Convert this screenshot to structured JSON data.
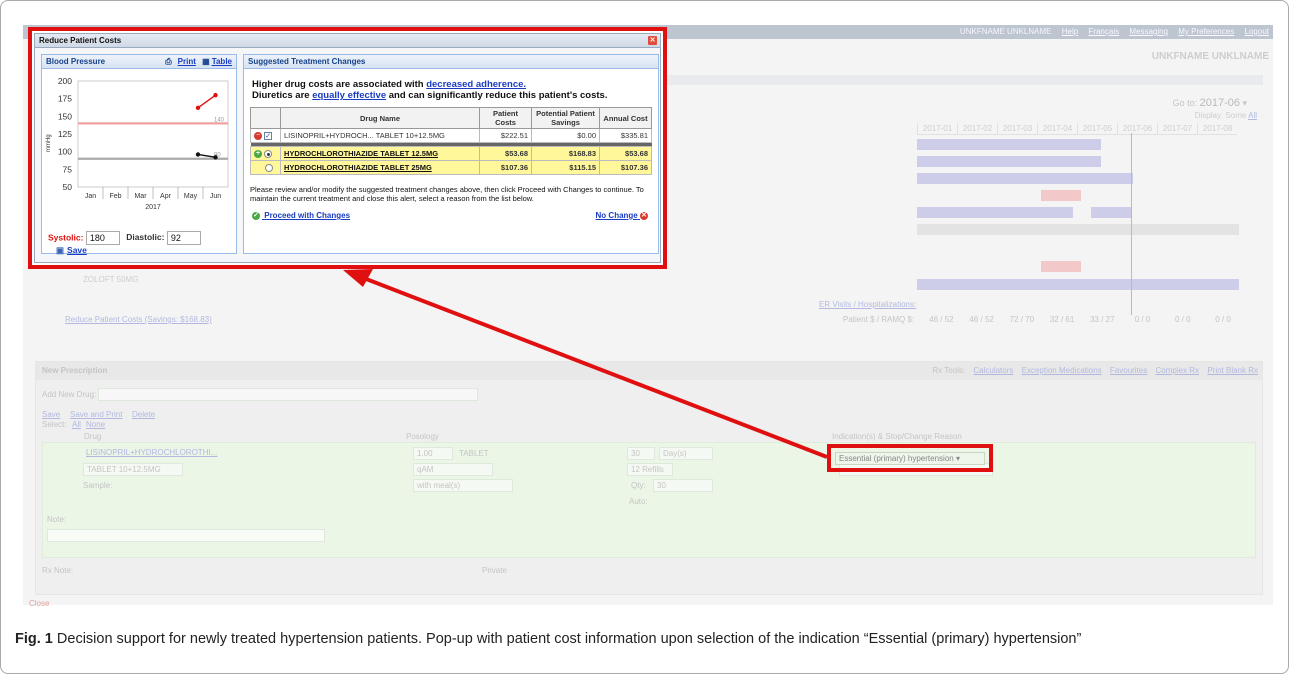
{
  "topbar": {
    "user": "UNKFNAME UNKLNAME",
    "help": "Help",
    "francais": "Français",
    "messaging": "Messaging",
    "preferences": "My Preferences",
    "logout": "Logout"
  },
  "user_name": "UNKFNAME UNKLNAME",
  "timeline": {
    "goto_label": "Go to:",
    "goto_value": "2017-06",
    "display_label": "Display: Some",
    "display_link": "All",
    "months": [
      "2017-01",
      "2017-02",
      "2017-03",
      "2017-04",
      "2017-05",
      "2017-06",
      "2017-07",
      "2017-08"
    ]
  },
  "med_row_zoloft": "ZOLOFT 50MG",
  "er_visits": "ER Visits / Hospitalizations:",
  "reduce_link": "Reduce Patient Costs (Savings: $168.83)",
  "patient_ramq": {
    "label": "Patient $ / RAMQ $:",
    "values": [
      "46 / 52",
      "46 / 52",
      "72 / 70",
      "32 / 61",
      "33 / 27",
      "0 / 0",
      "0 / 0",
      "0 / 0"
    ]
  },
  "new_prescription": {
    "title": "New Prescription",
    "rx_tools": "Rx Tools:",
    "tools": [
      "Calculators",
      "Exception Medications",
      "Favourites",
      "Complex Rx",
      "Print Blank Rx"
    ],
    "add_new_drug": "Add New Drug:",
    "save": "Save",
    "save_print": "Save and Print",
    "delete": "Delete",
    "select": "Select:",
    "select_all": "All",
    "select_none": "None",
    "col_drug": "Drug",
    "col_posology": "Posology",
    "col_indication": "Indication(s) & Stop/Change Reason",
    "drug_name": "LISINOPRIL+HYDROCHLOROTHI...",
    "drug_form": "TABLET 10+12.5MG",
    "sample": "Sample:",
    "dose": "1.00",
    "dose_unit": "TABLET",
    "freq": "qAM",
    "with_meal": "with meal(s)",
    "duration": "30",
    "duration_unit": "Day(s)",
    "refills": "12 Refills",
    "qty_label": "Qty:",
    "qty": "30",
    "auto_label": "Auto:",
    "indication": "Essential (primary) hypertension",
    "note": "Note:",
    "rx_note": "Rx Note:",
    "private": "Private",
    "close": "Close"
  },
  "popup": {
    "title": "Reduce Patient Costs",
    "bp_panel": {
      "title": "Blood Pressure",
      "print": "Print",
      "table": "Table",
      "ylabel": "mmHg",
      "systolic_label": "Systolic:",
      "systolic_value": "180",
      "diastolic_label": "Diastolic:",
      "diastolic_value": "92",
      "save": "Save"
    },
    "stc_panel": {
      "title": "Suggested Treatment Changes",
      "warn_line1_a": "Higher drug costs are associated with ",
      "warn_line1_link": "decreased adherence.",
      "warn_line2_a": "Diuretics are ",
      "warn_line2_link": "equally effective",
      "warn_line2_b": " and can significantly reduce this patient's costs.",
      "headers": [
        "Drug Name",
        "Patient Costs",
        "Potential Patient Savings",
        "Annual Cost"
      ],
      "rows": [
        {
          "name": "LISINOPRIL+HYDROCH... TABLET 10+12.5MG",
          "patient_cost": "$222.51",
          "savings": "$0.00",
          "annual": "$335.81"
        },
        {
          "name": "HYDROCHLOROTHIAZIDE TABLET 12.5MG",
          "patient_cost": "$53.68",
          "savings": "$168.83",
          "annual": "$53.68"
        },
        {
          "name": "HYDROCHLOROTHIAZIDE TABLET 25MG",
          "patient_cost": "$107.36",
          "savings": "$115.15",
          "annual": "$107.36"
        }
      ],
      "instructions": "Please review and/or modify the suggested treatment changes above, then click Proceed with Changes to continue. To maintain the current treatment and close this alert, select a reason from the list below.",
      "proceed": "Proceed with Changes",
      "no_change": "No Change"
    }
  },
  "chart_data": {
    "type": "line",
    "title": "",
    "xlabel": "2017",
    "ylabel": "mmHg",
    "categories": [
      "Jan",
      "Feb",
      "Mar",
      "Apr",
      "May",
      "Jun"
    ],
    "ylim": [
      50,
      200
    ],
    "yticks": [
      50,
      75,
      100,
      125,
      150,
      175,
      200
    ],
    "reference_lines": [
      {
        "value": 140,
        "label": "140",
        "color": "#f2a0a0"
      },
      {
        "value": 90,
        "label": "90",
        "color": "#aaaaaa"
      }
    ],
    "series": [
      {
        "color": "#e01010",
        "points": [
          [
            4.3,
            162
          ],
          [
            5.0,
            180
          ]
        ]
      },
      {
        "color": "#111111",
        "points": [
          [
            4.3,
            96
          ],
          [
            5.0,
            92
          ]
        ]
      }
    ]
  },
  "caption": {
    "fig": "Fig. 1",
    "text": " Decision support for newly treated hypertension patients. Pop-up with patient cost information upon selection of the indication “Essential (primary) hypertension”"
  }
}
